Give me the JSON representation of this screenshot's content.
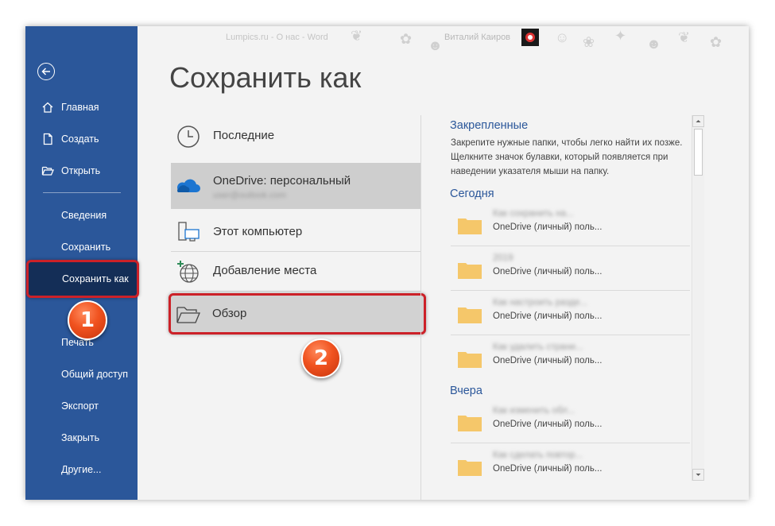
{
  "window": {
    "title": "Lumpics.ru - О нас  -  Word",
    "user": "Виталий Каиров"
  },
  "sidebar": {
    "items": [
      {
        "label": "Главная",
        "icon": "home-icon"
      },
      {
        "label": "Создать",
        "icon": "new-document-icon"
      },
      {
        "label": "Открыть",
        "icon": "open-folder-icon"
      },
      {
        "label": "Сведения"
      },
      {
        "label": "Сохранить"
      },
      {
        "label": "Сохранить как",
        "active": true
      },
      {
        "label": "Печать"
      },
      {
        "label": "Общий доступ"
      },
      {
        "label": "Экспорт"
      },
      {
        "label": "Закрыть"
      },
      {
        "label": "Другие..."
      }
    ]
  },
  "main": {
    "title": "Сохранить как",
    "locations": [
      {
        "label": "Последние",
        "icon": "clock-icon"
      },
      {
        "label": "OneDrive: персональный",
        "sublabel": "user@outlook.com",
        "icon": "onedrive-cloud-icon"
      },
      {
        "label": "Этот компьютер",
        "icon": "computer-icon"
      },
      {
        "label": "Добавление места",
        "icon": "globe-add-icon"
      },
      {
        "label": "Обзор",
        "icon": "folder-open-icon"
      }
    ]
  },
  "right": {
    "pinned_title": "Закрепленные",
    "pinned_desc": "Закрепите нужные папки, чтобы легко найти их позже. Щелкните значок булавки, который появляется при наведении указателя мыши на папку.",
    "today_title": "Сегодня",
    "yesterday_title": "Вчера",
    "today_files": [
      {
        "name": "Как сохранить на...",
        "location": "OneDrive (личный) поль..."
      },
      {
        "name": "2019",
        "location": "OneDrive (личный) поль..."
      },
      {
        "name": "Как настроить разде...",
        "location": "OneDrive (личный) поль..."
      },
      {
        "name": "Как удалить страни...",
        "location": "OneDrive (личный) поль..."
      }
    ],
    "yesterday_files": [
      {
        "name": "Как изменить обл...",
        "location": "OneDrive (личный) поль..."
      },
      {
        "name": "Как сделать повтор...",
        "location": "OneDrive (личный) поль..."
      }
    ]
  },
  "badges": {
    "one": "1",
    "two": "2"
  },
  "colors": {
    "sidebar": "#2b579a",
    "accent": "#2b579a",
    "highlight": "#cc2128",
    "badge": "#f0521f",
    "folder": "#f5c76a"
  }
}
